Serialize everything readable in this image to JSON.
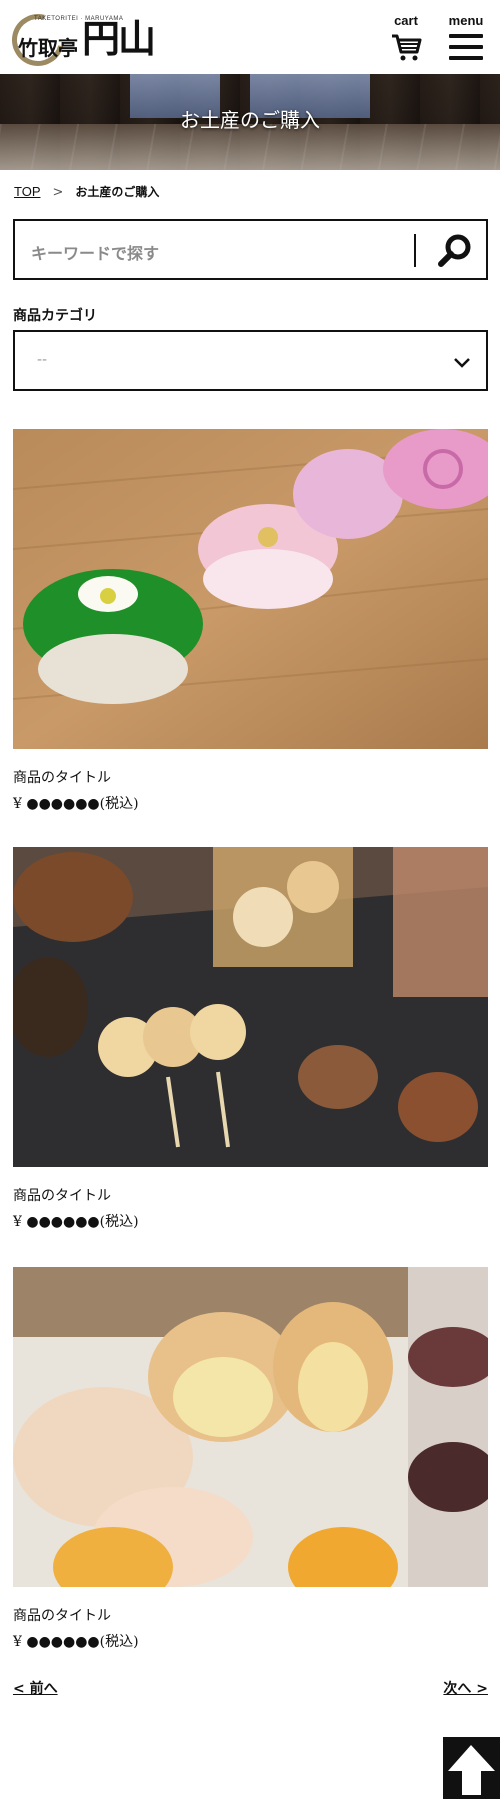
{
  "header": {
    "logo_sub": "TAKETORITEI · MARUYAMA",
    "logo_name": "竹取亭",
    "logo_brush": "円山",
    "cart_label": "cart",
    "menu_label": "menu"
  },
  "banner": {
    "title": "お土産のご購入"
  },
  "breadcrumb": {
    "top": "TOP",
    "separator": ">",
    "current": "お土産のご購入"
  },
  "search": {
    "placeholder": "キーワードで探す",
    "icon": "search-icon"
  },
  "category": {
    "label": "商品カテゴリ",
    "selected": "--"
  },
  "products": [
    {
      "title": "商品のタイトル",
      "price": "¥ ●●●●●●(税込)"
    },
    {
      "title": "商品のタイトル",
      "price": "¥ ●●●●●●(税込)"
    },
    {
      "title": "商品のタイトル",
      "price": "¥ ●●●●●●(税込)"
    }
  ],
  "pager": {
    "prev": "< 前へ",
    "next": "次へ >"
  },
  "colors": {
    "text": "#111111",
    "placeholder": "#8a8a8a",
    "border": "#111111",
    "logo_gold": "#9c8a62"
  }
}
